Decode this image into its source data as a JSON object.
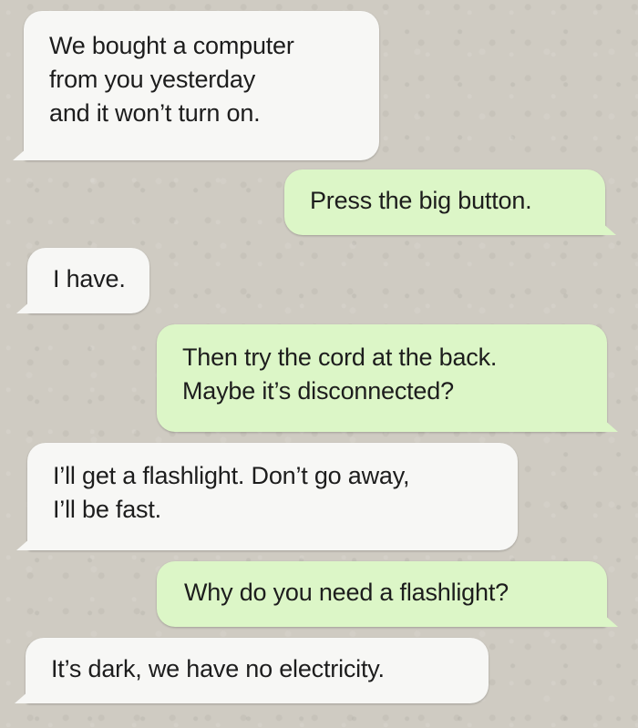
{
  "conversation": {
    "messages": [
      {
        "sender": "incoming",
        "text": "We bought a computer\nfrom you yesterday\nand it won’t turn on."
      },
      {
        "sender": "outgoing",
        "text": "Press the big button."
      },
      {
        "sender": "incoming",
        "text": "I have."
      },
      {
        "sender": "outgoing",
        "text": "Then try the cord at the back.\nMaybe it’s disconnected?"
      },
      {
        "sender": "incoming",
        "text": "I’ll get a flashlight. Don’t go away,\nI’ll be fast."
      },
      {
        "sender": "outgoing",
        "text": "Why do you need a flashlight?"
      },
      {
        "sender": "incoming",
        "text": "It’s dark, we have no electricity."
      }
    ]
  },
  "colors": {
    "background": "#cfcbc2",
    "incoming_bubble": "#f7f7f5",
    "outgoing_bubble": "#dcf6c7",
    "text": "#1d1d1d"
  }
}
